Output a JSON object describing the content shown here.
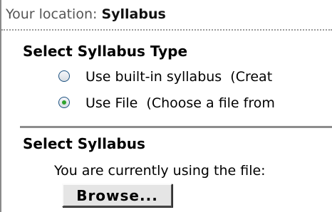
{
  "location": {
    "label": "Your location:",
    "value": "Syllabus"
  },
  "syllabus_type": {
    "title": "Select Syllabus Type",
    "options": [
      {
        "label": "Use built-in syllabus  (Creat",
        "selected": false
      },
      {
        "label": "Use File  (Choose a file from",
        "selected": true
      }
    ]
  },
  "syllabus_file": {
    "title": "Select Syllabus",
    "current_text": "You are currently using the file:",
    "browse_label": "Browse..."
  },
  "colors": {
    "radio_selected": "#2fa32f",
    "radio_border": "#1c5180"
  }
}
